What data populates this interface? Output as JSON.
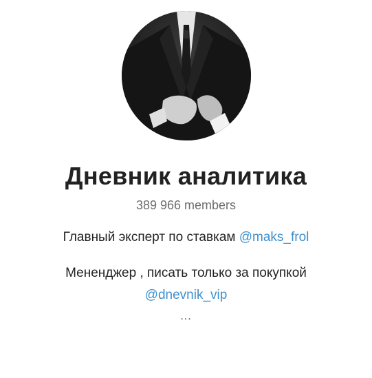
{
  "channel": {
    "title": "Дневник аналитика",
    "members": "389 966 members",
    "avatar_icon": "channel-avatar-photo"
  },
  "description": {
    "line1_text": "Главный эксперт по ставкам ",
    "line1_link": "@maks_frol",
    "line2_text": "Мененджер , писать только за покупкой",
    "line2_link": "@dnevnik_vip",
    "more": "..."
  },
  "colors": {
    "link": "#3d8fcc",
    "title": "#222222",
    "muted": "#6d6d6d"
  }
}
